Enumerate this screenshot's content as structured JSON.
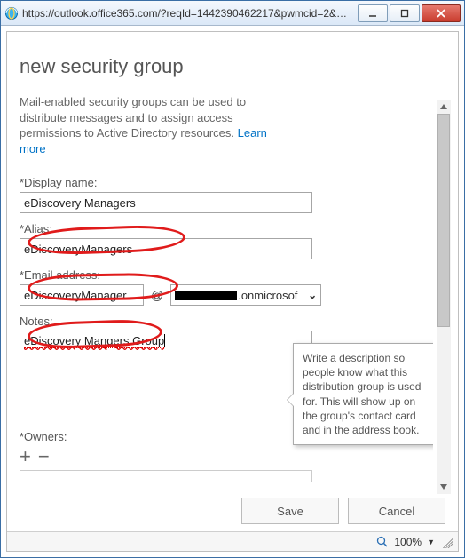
{
  "window": {
    "url": "https://outlook.office365.com/?reqId=1442390462217&pwmcid=2&Re..."
  },
  "page": {
    "title": "new security group",
    "intro_text": "Mail-enabled security groups can be used to distribute messages and to assign access permissions to Active Directory resources. ",
    "learn_more": "Learn more"
  },
  "fields": {
    "display_name_label": "*Display name:",
    "display_name_value": "eDiscovery Managers",
    "alias_label": "*Alias:",
    "alias_value": "eDiscoveryManagers",
    "email_label": "*Email address:",
    "email_local_value": "eDiscoveryManager",
    "email_at": "@",
    "email_domain_value": ".onmicrosof",
    "notes_label": "Notes:",
    "notes_value": "eDiscovery Mangers Group",
    "owners_label": "*Owners:"
  },
  "tooltip": {
    "text": "Write a description so people know what this distribution group is used for. This will show up on the group's contact card and in the address book."
  },
  "buttons": {
    "save": "Save",
    "cancel": "Cancel"
  },
  "status": {
    "zoom": "100%"
  }
}
